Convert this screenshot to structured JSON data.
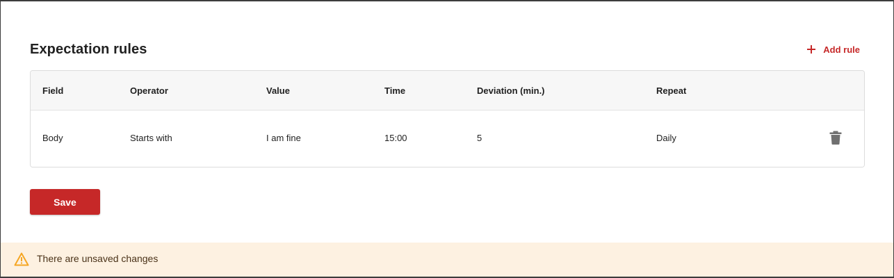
{
  "section": {
    "title": "Expectation rules",
    "add_rule_label": "Add rule"
  },
  "table": {
    "columns": [
      "Field",
      "Operator",
      "Value",
      "Time",
      "Deviation (min.)",
      "Repeat"
    ],
    "rows": [
      {
        "field": "Body",
        "operator": "Starts with",
        "value": "I am fine",
        "time": "15:00",
        "deviation": "5",
        "repeat": "Daily"
      }
    ]
  },
  "actions": {
    "save_label": "Save"
  },
  "banner": {
    "message": "There are unsaved changes"
  },
  "icons": {
    "add": "plus-icon",
    "delete": "trash-icon",
    "warning": "warning-icon"
  },
  "colors": {
    "accent": "#c62828",
    "banner_bg": "#fdf1e1",
    "warning": "#f5a623"
  }
}
